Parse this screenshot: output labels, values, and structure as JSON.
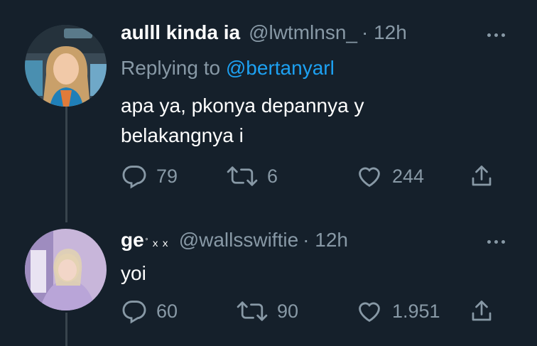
{
  "tweets": [
    {
      "name": "aulll kinda ia",
      "handle": "@lwtmlnsn_",
      "time": "· 12h",
      "replying_label": "Replying to",
      "replying_to": "@bertanyarl",
      "text_line1": "apa ya, pkonya depannya y",
      "text_line2": "belakangnya i",
      "replies": "79",
      "retweets": "6",
      "likes": "244"
    },
    {
      "name": "ge",
      "name_emoji": "ﾟｘｘ",
      "handle": "@wallsswiftie",
      "time": "· 12h",
      "text_line1": "yoi",
      "replies": "60",
      "retweets": "90",
      "likes": "1.951"
    }
  ],
  "colors": {
    "background": "#15202b",
    "secondary_text": "#8899a6",
    "link": "#1da1f2",
    "thread_line": "#38444d"
  },
  "icons": [
    "more-icon",
    "reply-icon",
    "retweet-icon",
    "like-icon",
    "share-icon"
  ]
}
